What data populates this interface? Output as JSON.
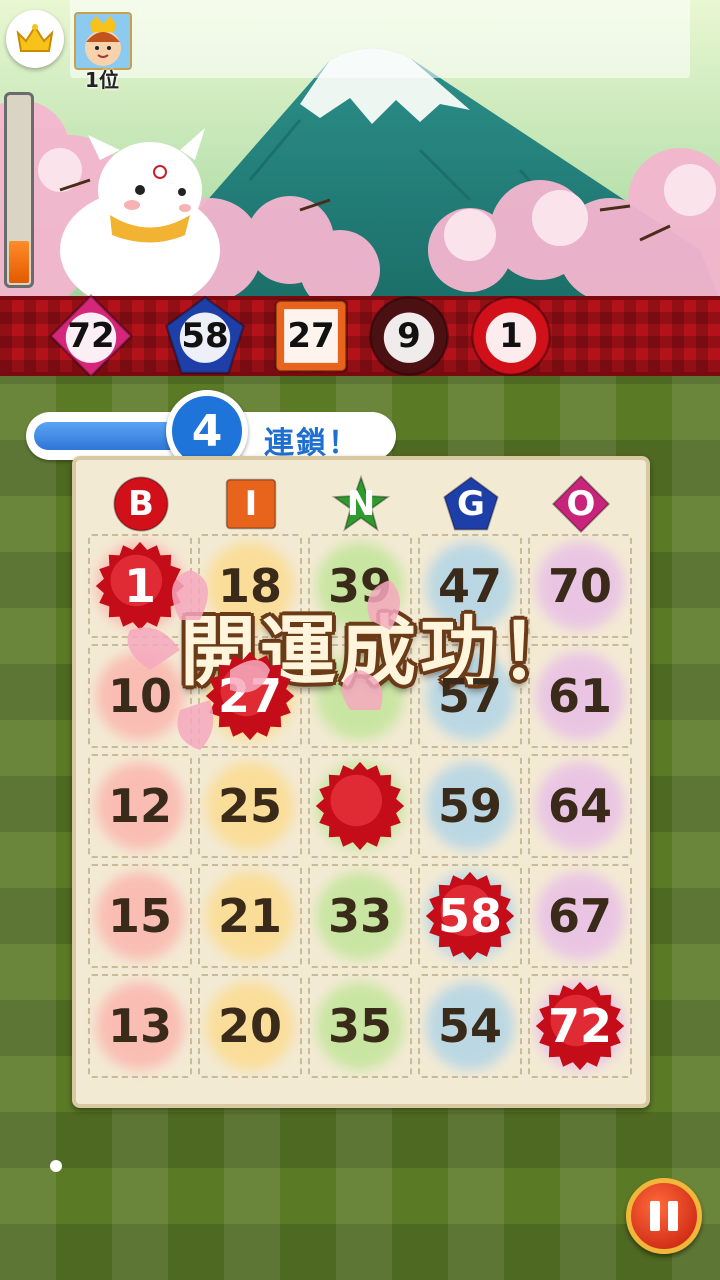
{
  "hud": {
    "rank_label": "1位",
    "crown_icon": "crown-icon",
    "power_level": 0.22
  },
  "called_balls": [
    {
      "number": "72",
      "shape": "diamond",
      "color": "#d6267a"
    },
    {
      "number": "58",
      "shape": "pentagon",
      "color": "#1f3fa8"
    },
    {
      "number": "27",
      "shape": "square",
      "color": "#e8641c"
    },
    {
      "number": "9",
      "shape": "circle",
      "color": "#4a1012"
    },
    {
      "number": "1",
      "shape": "circle",
      "color": "#d2101a"
    }
  ],
  "combo": {
    "count": "4",
    "label": "連鎖！",
    "progress": 0.45
  },
  "card": {
    "headers": [
      {
        "letter": "B",
        "color": "#d2101a"
      },
      {
        "letter": "I",
        "color": "#e8641c"
      },
      {
        "letter": "N",
        "color": "#2e9b2e"
      },
      {
        "letter": "G",
        "color": "#1f3fa8"
      },
      {
        "letter": "O",
        "color": "#c8247a"
      }
    ],
    "rows": [
      [
        "1",
        "18",
        "39",
        "47",
        "70"
      ],
      [
        "10",
        "27",
        "",
        "57",
        "61"
      ],
      [
        "12",
        "25",
        "",
        "59",
        "64"
      ],
      [
        "15",
        "21",
        "33",
        "58",
        "67"
      ],
      [
        "13",
        "20",
        "35",
        "54",
        "72"
      ]
    ],
    "marked": [
      [
        0,
        0
      ],
      [
        1,
        1
      ],
      [
        2,
        2
      ],
      [
        3,
        3
      ],
      [
        4,
        4
      ]
    ]
  },
  "overlay": {
    "message": "開運成功！"
  },
  "controls": {
    "pause_icon": "pause-icon"
  }
}
